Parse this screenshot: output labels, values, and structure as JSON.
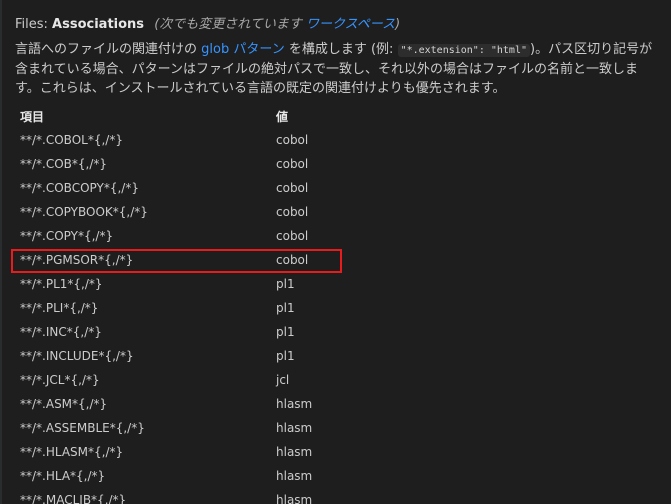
{
  "setting": {
    "category": "Files: ",
    "label": "Associations",
    "modified_prefix": "(次でも変更されています ",
    "modified_scope": "ワークスペース",
    "modified_suffix": ")",
    "description": {
      "part1": "言語へのファイルの関連付けの ",
      "link": "glob パターン",
      "part2": " を構成します (例: ",
      "code": "\"*.extension\": \"html\"",
      "part3": ")。パス区切り記号が含まれている場合、パターンはファイルの絶対パスで一致し、それ以外の場合はファイルの名前と一致します。これらは、インストールされている言語の既定の関連付けよりも優先されます。"
    }
  },
  "table": {
    "headers": {
      "key": "項目",
      "value": "値"
    },
    "rows": [
      {
        "key": "**/*.COBOL*{,/*}",
        "value": "cobol"
      },
      {
        "key": "**/*.COB*{,/*}",
        "value": "cobol"
      },
      {
        "key": "**/*.COBCOPY*{,/*}",
        "value": "cobol"
      },
      {
        "key": "**/*.COPYBOOK*{,/*}",
        "value": "cobol"
      },
      {
        "key": "**/*.COPY*{,/*}",
        "value": "cobol"
      },
      {
        "key": "**/*.PGMSOR*{,/*}",
        "value": "cobol"
      },
      {
        "key": "**/*.PL1*{,/*}",
        "value": "pl1"
      },
      {
        "key": "**/*.PLI*{,/*}",
        "value": "pl1"
      },
      {
        "key": "**/*.INC*{,/*}",
        "value": "pl1"
      },
      {
        "key": "**/*.INCLUDE*{,/*}",
        "value": "pl1"
      },
      {
        "key": "**/*.JCL*{,/*}",
        "value": "jcl"
      },
      {
        "key": "**/*.ASM*{,/*}",
        "value": "hlasm"
      },
      {
        "key": "**/*.ASSEMBLE*{,/*}",
        "value": "hlasm"
      },
      {
        "key": "**/*.HLASM*{,/*}",
        "value": "hlasm"
      },
      {
        "key": "**/*.HLA*{,/*}",
        "value": "hlasm"
      },
      {
        "key": "**/*.MACLIB*{,/*}",
        "value": "hlasm"
      }
    ]
  },
  "colors": {
    "background": "#1e1e1e",
    "link": "#3794ff",
    "highlight_border": "#e81c1c"
  }
}
